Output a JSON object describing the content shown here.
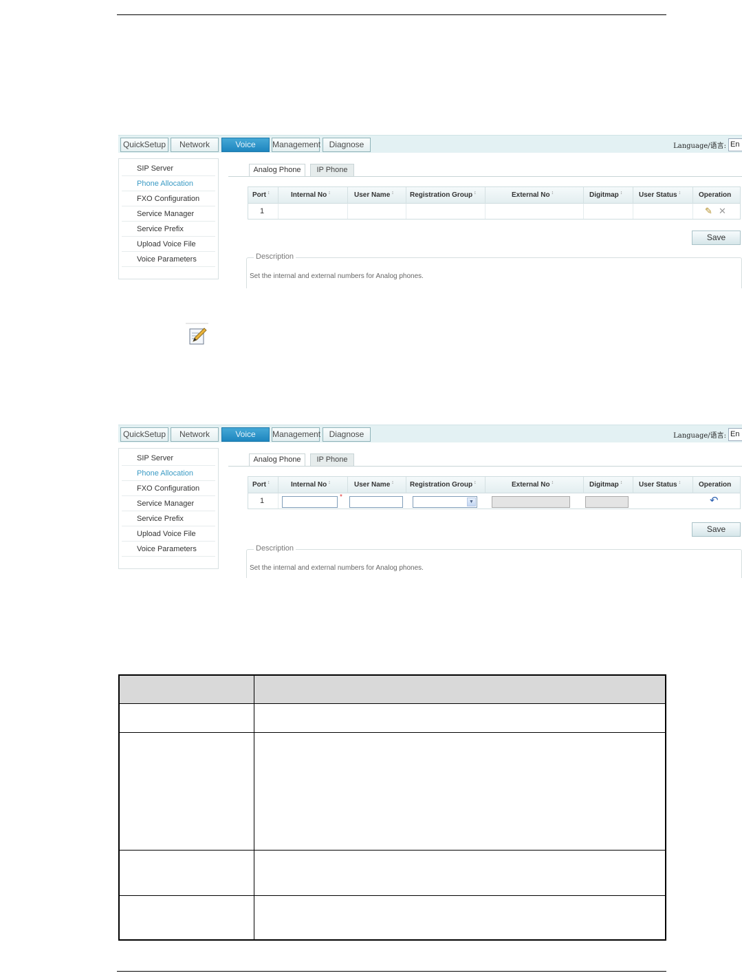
{
  "nav": {
    "buttons": [
      "QuickSetup",
      "Network",
      "Voice",
      "Management",
      "Diagnose"
    ],
    "language_label": "Language/语言:",
    "language_value": "En"
  },
  "sidebar": {
    "items": [
      "SIP Server",
      "Phone Allocation",
      "FXO Configuration",
      "Service Manager",
      "Service Prefix",
      "Upload Voice File",
      "Voice Parameters"
    ]
  },
  "tabs": [
    "Analog Phone",
    "IP Phone"
  ],
  "table": {
    "columns": [
      "Port",
      "Internal No",
      "User Name",
      "Registration Group",
      "External No",
      "Digitmap",
      "User Status",
      "Operation"
    ],
    "sort_glyph": "↕",
    "row_port": "1",
    "required_mark": "*",
    "select_arrow": "▼",
    "edit_glyph": "✎",
    "delete_glyph": "✕",
    "undo_glyph": "↶"
  },
  "save_label": "Save",
  "description": {
    "legend": "Description",
    "text": "Set the internal and external numbers for Analog phones."
  },
  "colors": {
    "nav_active": "#2a93c9",
    "nav_bar": "#e3f1f3",
    "sidebar_active_text": "#3a9ac4",
    "doc_table_header": "#d9d9d9"
  }
}
